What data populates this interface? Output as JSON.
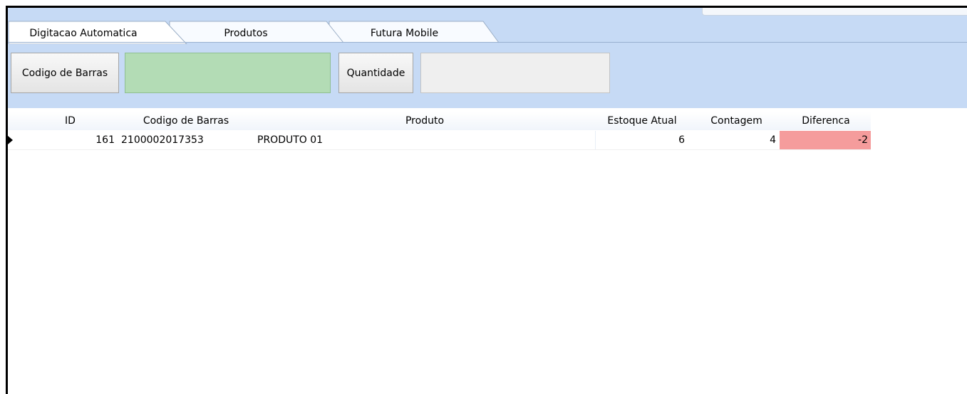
{
  "tabs": [
    {
      "label": "Digitacao Automatica",
      "active": true
    },
    {
      "label": "Produtos",
      "active": false
    },
    {
      "label": "Futura Mobile",
      "active": false
    }
  ],
  "toolbar": {
    "barcode_button_label": "Codigo de Barras",
    "barcode_value": "",
    "quantity_button_label": "Quantidade",
    "quantity_value": ""
  },
  "grid": {
    "columns": [
      "ID",
      "Codigo de Barras",
      "Produto",
      "Estoque Atual",
      "Contagem",
      "Diferenca"
    ],
    "rows": [
      {
        "id": "161",
        "barcode": "2100002017353",
        "product": "PRODUTO 01",
        "stock": "6",
        "count": "4",
        "difference": "-2"
      }
    ]
  },
  "colors": {
    "panel": "#c6daf5",
    "barcode_input": "#b3dcb5",
    "negative_difference": "#f59c9c"
  }
}
